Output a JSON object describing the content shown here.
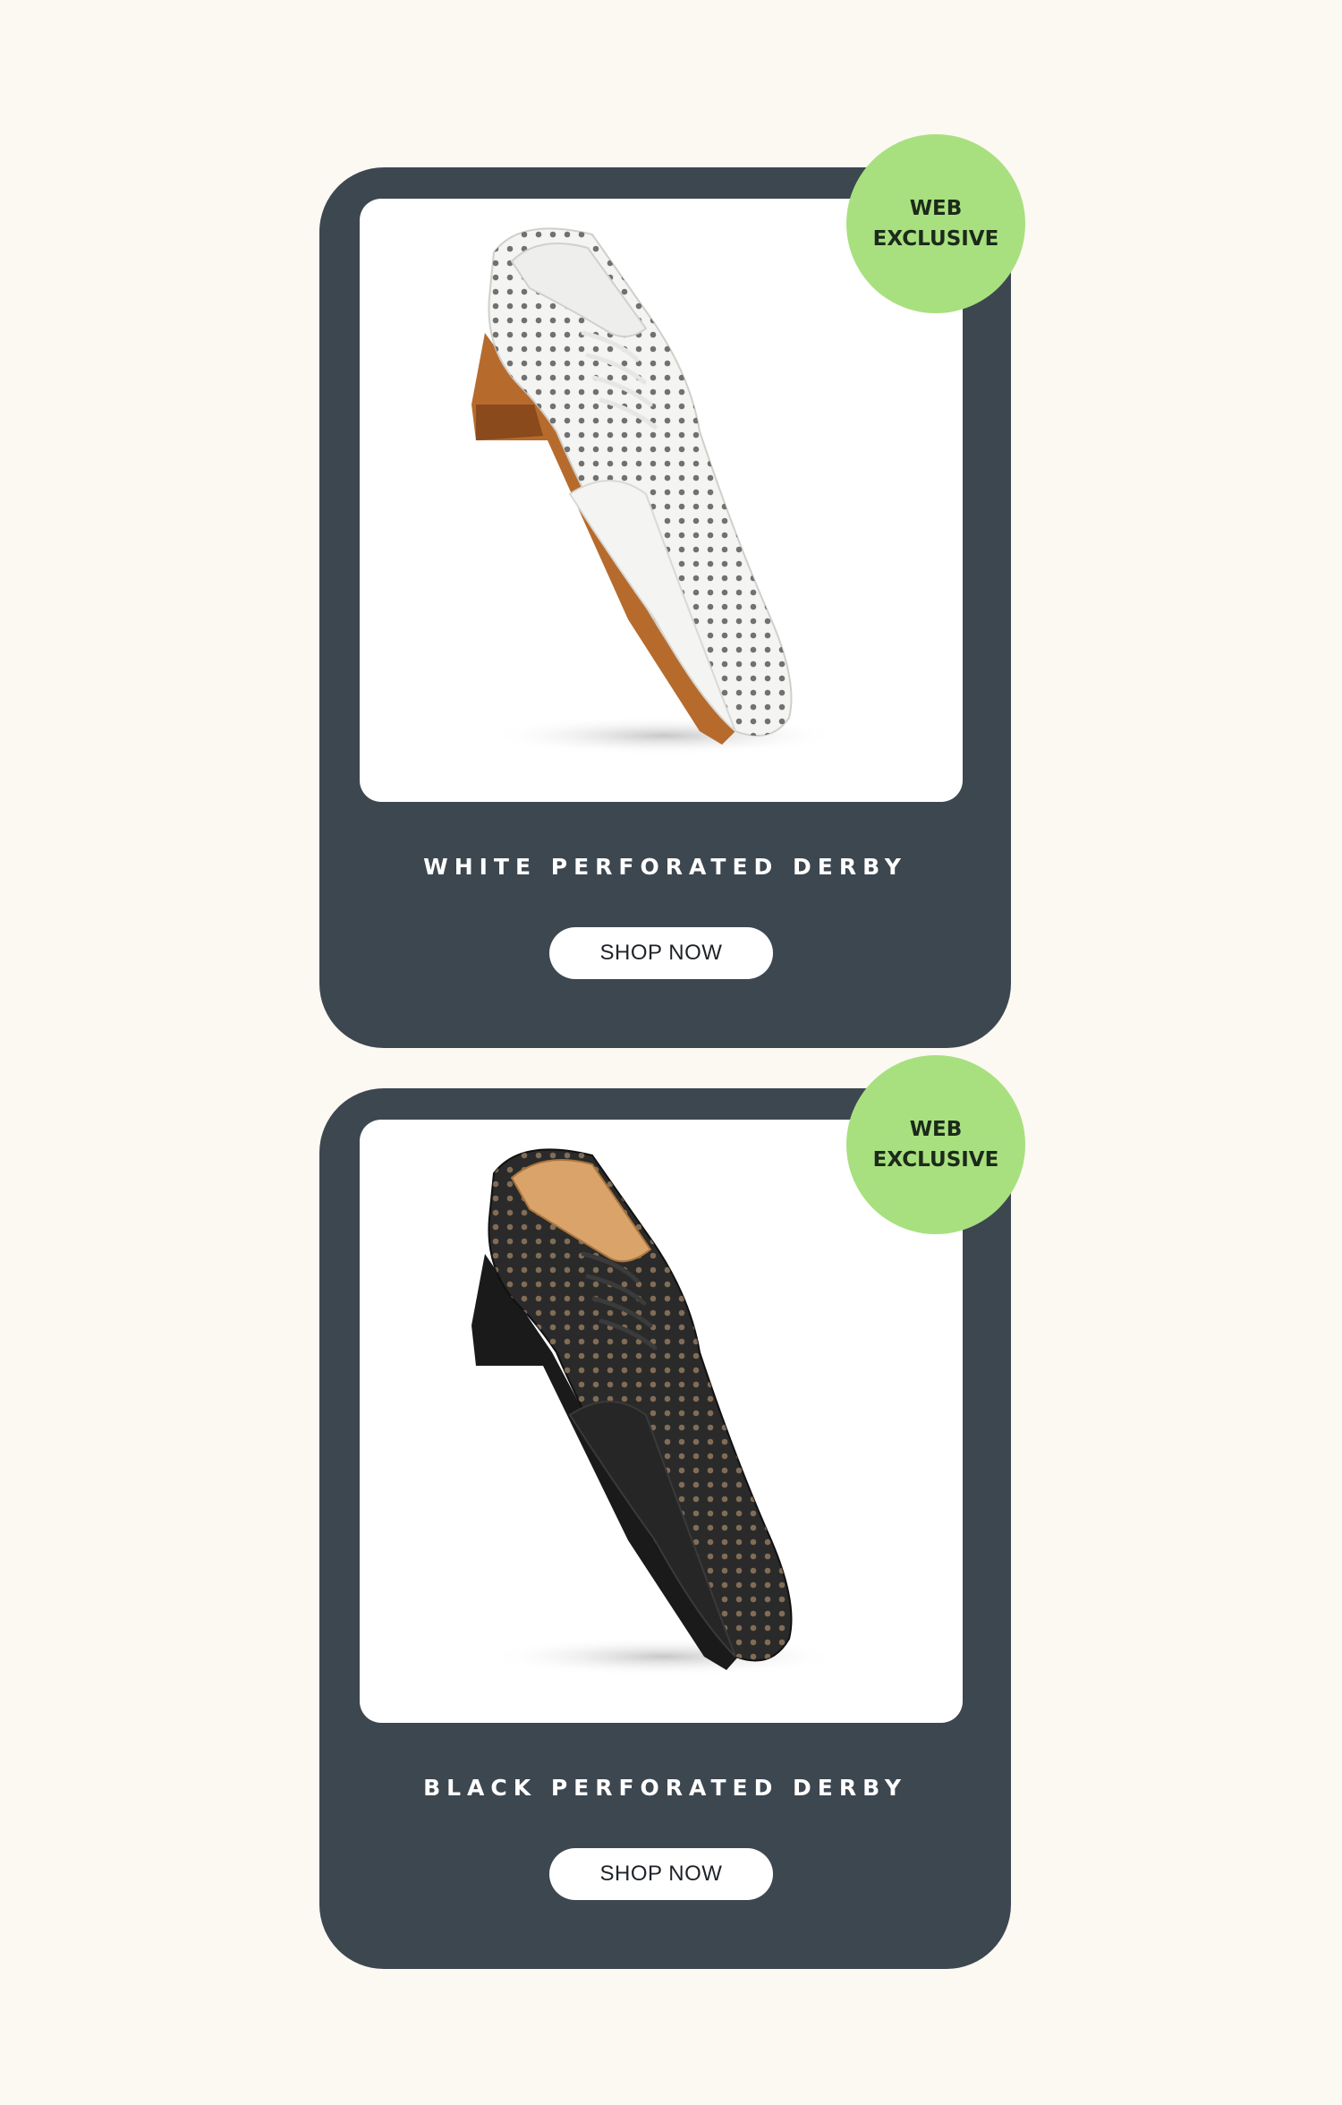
{
  "products": [
    {
      "title": "WHITE PERFORATED DERBY",
      "button_label": "SHOP NOW",
      "badge_line1": "WEB",
      "badge_line2": "EXCLUSIVE",
      "image": "white-perforated-derby-shoe"
    },
    {
      "title": "BLACK PERFORATED DERBY",
      "button_label": "SHOP NOW",
      "badge_line1": "WEB",
      "badge_line2": "EXCLUSIVE",
      "image": "black-perforated-derby-shoe"
    }
  ],
  "colors": {
    "page_background": "#fcf8f2",
    "card_background": "#3d4750",
    "badge_background": "#a8e07f",
    "button_background": "#ffffff"
  }
}
